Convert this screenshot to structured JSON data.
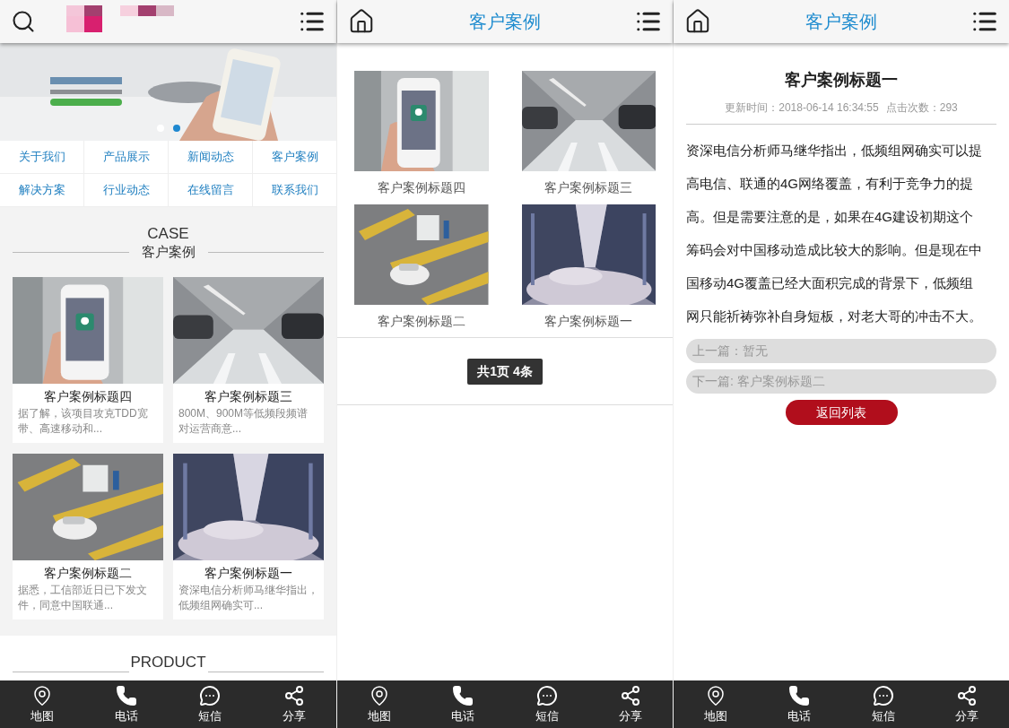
{
  "home": {
    "banner": {
      "dots": [
        {
          "selected": false
        },
        {
          "selected": true
        }
      ]
    },
    "nav": [
      "关于我们",
      "产品展示",
      "新闻动态",
      "客户案例",
      "解决方案",
      "行业动态",
      "在线留言",
      "联系我们"
    ],
    "section": {
      "title_en": "CASE",
      "title_zh": "客户案例"
    },
    "cases": [
      {
        "title": "客户案例标题四",
        "summary": "据了解，该项目攻克TDD宽带、高速移动和..."
      },
      {
        "title": "客户案例标题三",
        "summary": "800M、900M等低频段频谱对运营商意..."
      },
      {
        "title": "客户案例标题二",
        "summary": "据悉，工信部近日已下发文件，同意中国联通..."
      },
      {
        "title": "客户案例标题一",
        "summary": "资深电信分析师马继华指出，低频组网确实可..."
      }
    ],
    "next_section": {
      "title_en": "PRODUCT"
    },
    "bottom_bar": [
      "地图",
      "电话",
      "短信",
      "分享"
    ]
  },
  "list_page": {
    "header": {
      "title": "客户案例"
    },
    "cases": [
      "客户案例标题四",
      "客户案例标题三",
      "客户案例标题二",
      "客户案例标题一"
    ],
    "pagination": "共1页 4条",
    "bottom_bar": [
      "地图",
      "电话",
      "短信",
      "分享"
    ]
  },
  "detail_page": {
    "header": {
      "title": "客户案例"
    },
    "article": {
      "title": "客户案例标题一",
      "updated": "更新时间：2018-06-14 16:34:55",
      "views": "点击次数：293",
      "body": "资深电信分析师马继华指出，低频组网确实可以提高电信、联通的4G网络覆盖，有利于竞争力的提高。但是需要注意的是，如果在4G建设初期这个筹码会对中国移动造成比较大的影响。但是现在中国移动4G覆盖已经大面积完成的背景下，低频组网只能祈祷弥补自身短板，对老大哥的冲击不大。",
      "prev": "上一篇：暂无",
      "next": "下一篇: 客户案例标题二"
    },
    "back_button": "返回列表",
    "bottom_bar": [
      "地图",
      "电话",
      "短信",
      "分享"
    ]
  }
}
